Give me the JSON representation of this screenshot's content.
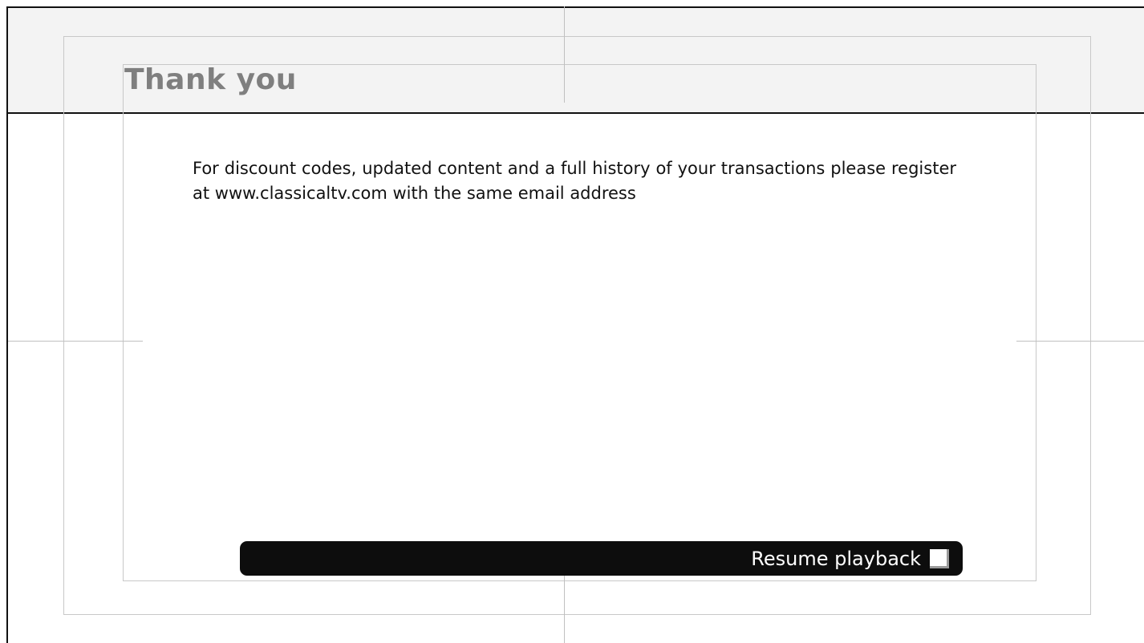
{
  "page": {
    "title": "Thank you",
    "message": "For discount codes, updated content and a full history of your transactions please register at www.classicaltv.com with the same email address"
  },
  "resume": {
    "label": "Resume playback",
    "key_icon": "square-key-icon"
  }
}
